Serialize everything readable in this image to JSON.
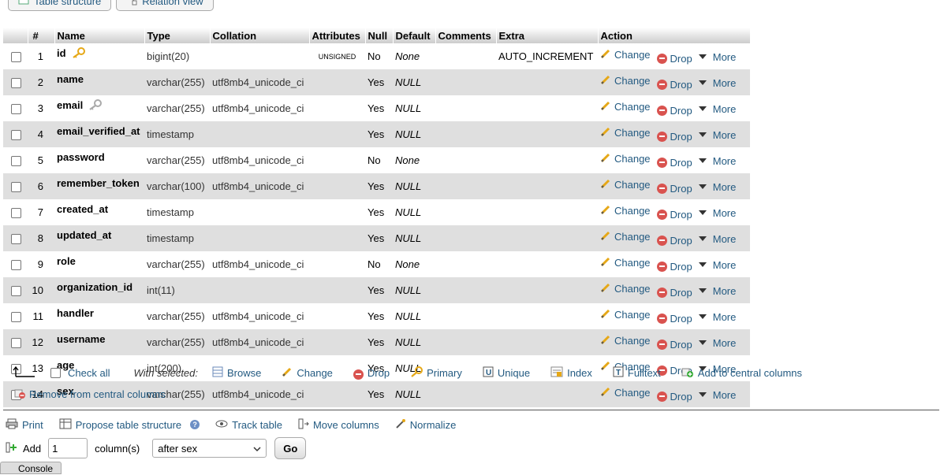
{
  "tabs": [
    {
      "label": "Table structure",
      "icon": "table-structure-icon"
    },
    {
      "label": "Relation view",
      "icon": "relation-view-icon"
    }
  ],
  "table": {
    "headers": [
      "#",
      "Name",
      "Type",
      "Collation",
      "Attributes",
      "Null",
      "Default",
      "Comments",
      "Extra",
      "Action"
    ],
    "rows": [
      {
        "num": "1",
        "name": "id",
        "type": "bigint(20)",
        "collation": "",
        "attributes": "UNSIGNED",
        "null": "No",
        "default": "None",
        "comments": "",
        "extra": "AUTO_INCREMENT",
        "key": "primary"
      },
      {
        "num": "2",
        "name": "name",
        "type": "varchar(255)",
        "collation": "utf8mb4_unicode_ci",
        "attributes": "",
        "null": "Yes",
        "default": "NULL",
        "comments": "",
        "extra": "",
        "key": ""
      },
      {
        "num": "3",
        "name": "email",
        "type": "varchar(255)",
        "collation": "utf8mb4_unicode_ci",
        "attributes": "",
        "null": "Yes",
        "default": "NULL",
        "comments": "",
        "extra": "",
        "key": "index"
      },
      {
        "num": "4",
        "name": "email_verified_at",
        "type": "timestamp",
        "collation": "",
        "attributes": "",
        "null": "Yes",
        "default": "NULL",
        "comments": "",
        "extra": "",
        "key": ""
      },
      {
        "num": "5",
        "name": "password",
        "type": "varchar(255)",
        "collation": "utf8mb4_unicode_ci",
        "attributes": "",
        "null": "No",
        "default": "None",
        "comments": "",
        "extra": "",
        "key": ""
      },
      {
        "num": "6",
        "name": "remember_token",
        "type": "varchar(100)",
        "collation": "utf8mb4_unicode_ci",
        "attributes": "",
        "null": "Yes",
        "default": "NULL",
        "comments": "",
        "extra": "",
        "key": ""
      },
      {
        "num": "7",
        "name": "created_at",
        "type": "timestamp",
        "collation": "",
        "attributes": "",
        "null": "Yes",
        "default": "NULL",
        "comments": "",
        "extra": "",
        "key": ""
      },
      {
        "num": "8",
        "name": "updated_at",
        "type": "timestamp",
        "collation": "",
        "attributes": "",
        "null": "Yes",
        "default": "NULL",
        "comments": "",
        "extra": "",
        "key": ""
      },
      {
        "num": "9",
        "name": "role",
        "type": "varchar(255)",
        "collation": "utf8mb4_unicode_ci",
        "attributes": "",
        "null": "No",
        "default": "None",
        "comments": "",
        "extra": "",
        "key": ""
      },
      {
        "num": "10",
        "name": "organization_id",
        "type": "int(11)",
        "collation": "",
        "attributes": "",
        "null": "Yes",
        "default": "NULL",
        "comments": "",
        "extra": "",
        "key": ""
      },
      {
        "num": "11",
        "name": "handler",
        "type": "varchar(255)",
        "collation": "utf8mb4_unicode_ci",
        "attributes": "",
        "null": "Yes",
        "default": "NULL",
        "comments": "",
        "extra": "",
        "key": ""
      },
      {
        "num": "12",
        "name": "username",
        "type": "varchar(255)",
        "collation": "utf8mb4_unicode_ci",
        "attributes": "",
        "null": "Yes",
        "default": "NULL",
        "comments": "",
        "extra": "",
        "key": ""
      },
      {
        "num": "13",
        "name": "age",
        "type": "int(200)",
        "collation": "",
        "attributes": "",
        "null": "Yes",
        "default": "NULL",
        "comments": "",
        "extra": "",
        "key": ""
      },
      {
        "num": "14",
        "name": "sex",
        "type": "varchar(255)",
        "collation": "utf8mb4_unicode_ci",
        "attributes": "",
        "null": "Yes",
        "default": "NULL",
        "comments": "",
        "extra": "",
        "key": ""
      }
    ],
    "actions": {
      "change": "Change",
      "drop": "Drop",
      "more": "More"
    }
  },
  "selected_bar": {
    "check_all": "Check all",
    "with_selected": "With selected:",
    "items": [
      {
        "label": "Browse",
        "icon": "browse-icon"
      },
      {
        "label": "Change",
        "icon": "pencil-icon"
      },
      {
        "label": "Drop",
        "icon": "drop-icon"
      },
      {
        "label": "Primary",
        "icon": "primary-key-icon"
      },
      {
        "label": "Unique",
        "icon": "unique-icon"
      },
      {
        "label": "Index",
        "icon": "index-icon"
      },
      {
        "label": "Fulltext",
        "icon": "fulltext-icon"
      },
      {
        "label": "Add to central columns",
        "icon": "add-central-columns-icon"
      }
    ],
    "remove_central": "Remove from central columns"
  },
  "bottom_links": [
    {
      "label": "Print",
      "icon": "print-icon"
    },
    {
      "label": "Propose table structure",
      "icon": "propose-structure-icon"
    },
    {
      "label": "Track table",
      "icon": "eye-icon"
    },
    {
      "label": "Move columns",
      "icon": "move-columns-icon"
    },
    {
      "label": "Normalize",
      "icon": "normalize-icon"
    }
  ],
  "add_columns": {
    "label": "Add",
    "value": "1",
    "suffix": "column(s)",
    "position": "after sex",
    "go": "Go"
  },
  "console": "Console",
  "colors": {
    "link": "#235a81",
    "row_even": "#dfdfdf",
    "drop": "#d9534f",
    "key_gold": "#e6a817"
  }
}
